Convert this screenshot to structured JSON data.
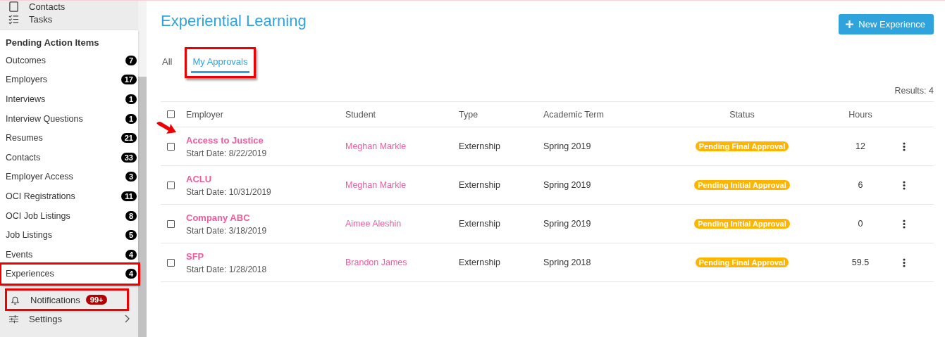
{
  "sidebar": {
    "nav_items": [
      {
        "label": "Contacts",
        "kind": "contacts"
      },
      {
        "label": "Tasks",
        "kind": "tasks"
      }
    ],
    "pending_panel": {
      "title": "Pending Action Items",
      "items": [
        {
          "label": "Outcomes",
          "count": "7",
          "highlighted": false
        },
        {
          "label": "Employers",
          "count": "17",
          "highlighted": false
        },
        {
          "label": "Interviews",
          "count": "1",
          "highlighted": false
        },
        {
          "label": "Interview Questions",
          "count": "1",
          "highlighted": false
        },
        {
          "label": "Resumes",
          "count": "21",
          "highlighted": false
        },
        {
          "label": "Contacts",
          "count": "33",
          "highlighted": false
        },
        {
          "label": "Employer Access",
          "count": "3",
          "highlighted": false
        },
        {
          "label": "OCI Registrations",
          "count": "11",
          "highlighted": false
        },
        {
          "label": "OCI Job Listings",
          "count": "8",
          "highlighted": false
        },
        {
          "label": "Job Listings",
          "count": "5",
          "highlighted": false
        },
        {
          "label": "Events",
          "count": "4",
          "highlighted": false
        },
        {
          "label": "Experiences",
          "count": "4",
          "highlighted": true
        }
      ]
    },
    "notifications": {
      "label": "Notifications",
      "badge": "99+",
      "highlighted": true
    },
    "settings": {
      "label": "Settings"
    }
  },
  "page": {
    "title": "Experiential Learning",
    "new_button": "New Experience",
    "tabs": [
      {
        "label": "All",
        "selected": false,
        "highlighted": false
      },
      {
        "label": "My Approvals",
        "selected": true,
        "highlighted": true
      }
    ],
    "results": "Results: 4",
    "table": {
      "select_all_checked": false,
      "columns": [
        "Employer",
        "Student",
        "Type",
        "Academic Term",
        "Status",
        "Hours"
      ],
      "rows": [
        {
          "employer": "Access to Justice",
          "start_date": "Start Date: 8/22/2019",
          "student": "Meghan Markle",
          "type": "Externship",
          "term": "Spring 2019",
          "status": "Pending Final Approval",
          "hours": "12",
          "checked": false,
          "pointer_arrow": true
        },
        {
          "employer": "ACLU",
          "start_date": "Start Date: 10/31/2019",
          "student": "Meghan Markle",
          "type": "Externship",
          "term": "Spring 2019",
          "status": "Pending Initial Approval",
          "hours": "6",
          "checked": false,
          "pointer_arrow": false
        },
        {
          "employer": "Company ABC",
          "start_date": "Start Date: 3/18/2019",
          "student": "Aimee Aleshin",
          "type": "Externship",
          "term": "Spring 2019",
          "status": "Pending Initial Approval",
          "hours": "0",
          "checked": false,
          "pointer_arrow": false
        },
        {
          "employer": "SFP",
          "start_date": "Start Date: 1/28/2018",
          "student": "Brandon James",
          "type": "Externship",
          "term": "Spring 2018",
          "status": "Pending Final Approval",
          "hours": "59.5",
          "checked": false,
          "pointer_arrow": false
        }
      ]
    }
  }
}
